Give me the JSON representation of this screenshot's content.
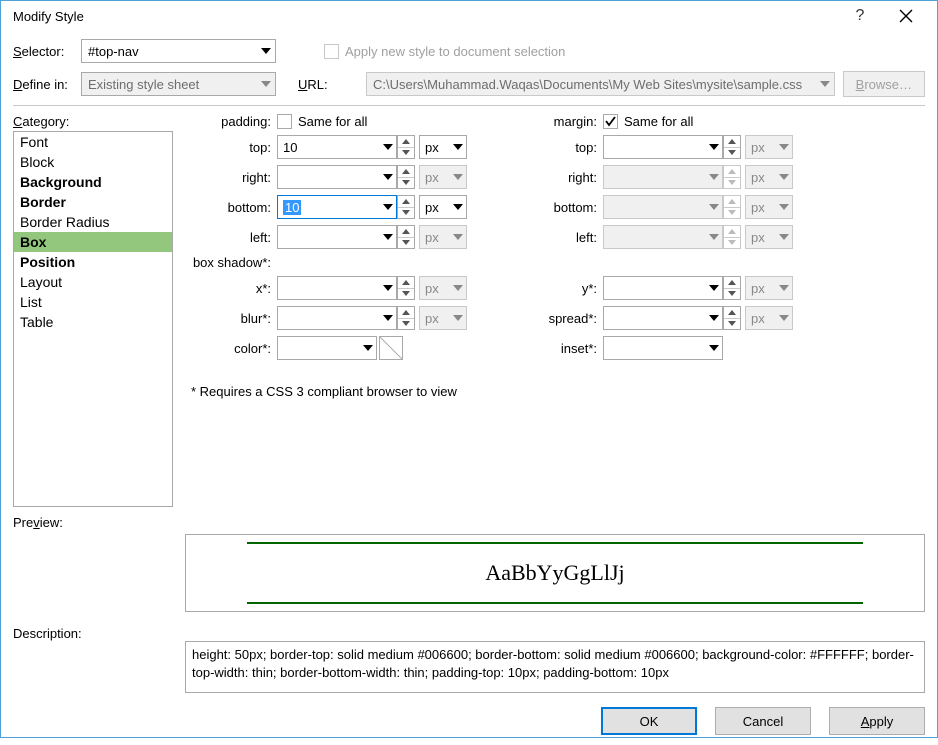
{
  "title": "Modify Style",
  "selector": {
    "label": "Selector:",
    "value": "#top-nav"
  },
  "apply_new": {
    "label": "Apply new style to document selection"
  },
  "definein": {
    "label": "Define in:",
    "value": "Existing style sheet"
  },
  "url": {
    "label": "URL:",
    "value": "C:\\Users\\Muhammad.Waqas\\Documents\\My Web Sites\\mysite\\sample.css"
  },
  "browse": "Browse…",
  "category_label": "Category:",
  "categories": [
    "Font",
    "Block",
    "Background",
    "Border",
    "Border Radius",
    "Box",
    "Position",
    "Layout",
    "List",
    "Table"
  ],
  "labels": {
    "padding": "padding:",
    "top": "top:",
    "right": "right:",
    "bottom": "bottom:",
    "left": "left:",
    "margin": "margin:",
    "boxshadow": "box shadow*:",
    "x": "x*:",
    "y": "y*:",
    "blur": "blur*:",
    "spread": "spread*:",
    "color": "color*:",
    "inset": "inset*:",
    "same": "Same for all",
    "px": "px"
  },
  "values": {
    "padding_top": "10",
    "padding_right": "",
    "padding_bottom": "10",
    "padding_left": "",
    "margin_top": "",
    "margin_right": "",
    "margin_bottom": "",
    "margin_left": "",
    "shadow_x": "",
    "shadow_y": "",
    "shadow_blur": "",
    "shadow_spread": "",
    "shadow_color": "",
    "inset": ""
  },
  "margin_same": true,
  "padding_same": false,
  "note": "* Requires a CSS 3 compliant browser to view",
  "preview_label": "Preview:",
  "preview_text": "AaBbYyGgLlJj",
  "description_label": "Description:",
  "description_text": "height: 50px; border-top: solid medium #006600; border-bottom: solid medium #006600; background-color: #FFFFFF; border-top-width: thin; border-bottom-width: thin; padding-top: 10px; padding-bottom: 10px",
  "buttons": {
    "ok": "OK",
    "cancel": "Cancel",
    "apply": "Apply"
  }
}
